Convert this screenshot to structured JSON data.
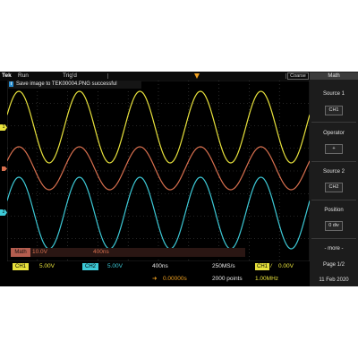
{
  "topbar": {
    "brand": "Tek",
    "run_status": "Run",
    "trigger_status": "Trig'd",
    "coarse_label": "Coarse"
  },
  "notification": {
    "text": "Save image to TEK00004.PNG successful"
  },
  "markers": {
    "ch1": "1",
    "ch2": "2"
  },
  "math_readout": {
    "label": "Math",
    "scale": "10.0V",
    "timebase": "400ns"
  },
  "bottom": {
    "ch1_label": "CH1",
    "ch1_scale": "5.00V",
    "ch2_label": "CH2",
    "ch2_scale": "5.00V",
    "time_per_div": "400ns",
    "sample_rate": "250MS/s",
    "trigger_source": "CH1",
    "trigger_level": "0.00V",
    "horizontal_position": "0.00000s",
    "record_length": "2000 points",
    "frequency": "1.00MHz",
    "date": "11 Feb 2020"
  },
  "sidebar": {
    "title": "Math",
    "source1_label": "Source 1",
    "source1_value": "CH1",
    "operator_label": "Operator",
    "operator_value": "+",
    "source2_label": "Source 2",
    "source2_value": "CH2",
    "position_label": "Position",
    "position_value": "0 div",
    "more_label": "- more -",
    "page_label": "Page 1/2"
  },
  "colors": {
    "ch1": "#e8e23c",
    "ch2": "#3dc9d6",
    "math": "#d9704f",
    "grid": "#4a4a4a",
    "trigger": "#f0a020"
  },
  "signal": {
    "waveform": "sine",
    "cycles_on_screen": 5
  }
}
